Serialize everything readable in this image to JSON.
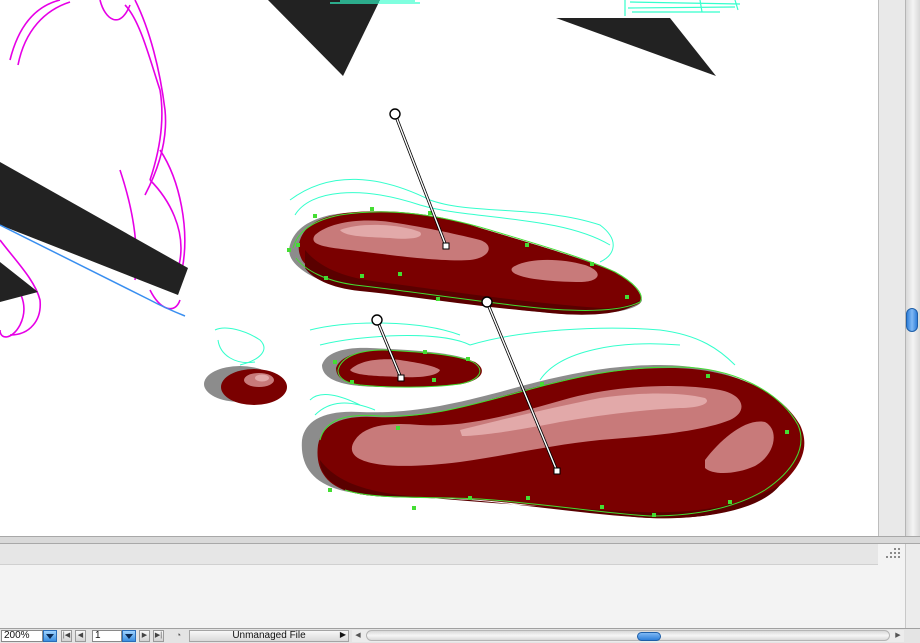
{
  "statusbar": {
    "zoom": "200%",
    "page": "1",
    "file_status": "Unmanaged File",
    "nav_first": "|◀",
    "nav_prev": "◀",
    "nav_next": "▶",
    "nav_last": "▶|",
    "file_status_arrow": "▶",
    "hscroll_left": "◀",
    "hscroll_right": "▶"
  },
  "scroll": {
    "vertical_position": 0.6,
    "horizontal_position": 0.52
  },
  "colors": {
    "puddle_dark": "#5a0000",
    "puddle_main": "#7a0000",
    "puddle_highlight": "#c87a7a",
    "puddle_shadow": "#8c8c8c",
    "sketch_magenta": "#e600e6",
    "sketch_cyan": "#33ffcc",
    "path_green": "#44dd33",
    "shape_black": "#222222",
    "selection_blue": "#3a8ff0"
  },
  "icons": {
    "zoom_dropdown": "chevron-down-icon",
    "page_dropdown": "chevron-down-icon",
    "document_status": "document-icon",
    "panel_grip": "grip-icon"
  }
}
